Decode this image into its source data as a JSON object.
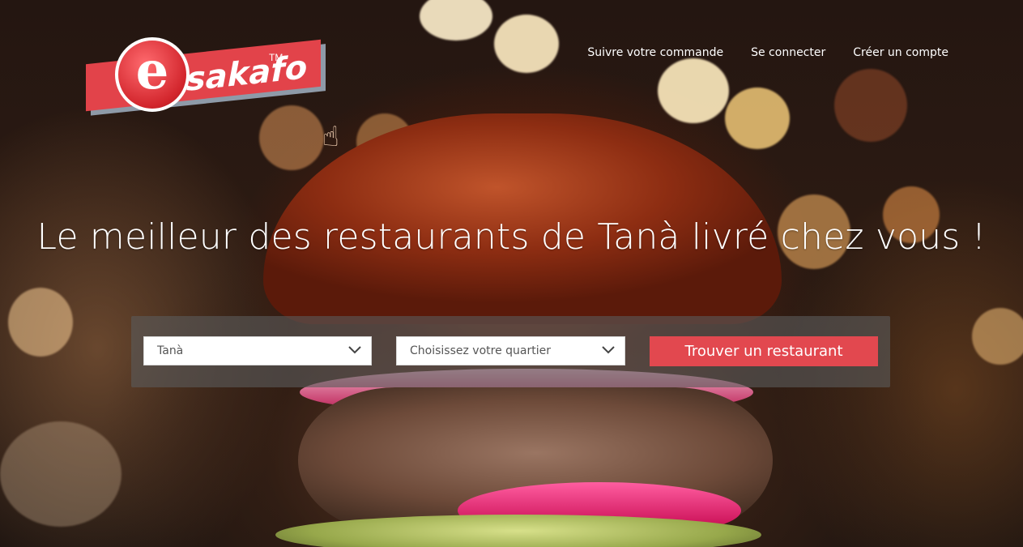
{
  "brand": {
    "logo_letter": "e",
    "logo_text": "sakafo",
    "trademark": "TM",
    "colors": {
      "primary_red": "#e2434a",
      "panel_gray": "#5a5a5a"
    }
  },
  "nav": {
    "items": [
      {
        "label": "Suivre votre commande"
      },
      {
        "label": "Se connecter"
      },
      {
        "label": "Créer un compte"
      }
    ]
  },
  "hero": {
    "headline": "Le meilleur des restaurants de Tanà livré chez vous !"
  },
  "search": {
    "city_select": {
      "value": "Tanà",
      "icon": "chevron-down-icon"
    },
    "quarter_select": {
      "placeholder": "Choisissez votre quartier",
      "icon": "chevron-down-icon"
    },
    "submit_label": "Trouver un restaurant"
  },
  "cursor": {
    "icon": "hand-pointer-icon"
  }
}
